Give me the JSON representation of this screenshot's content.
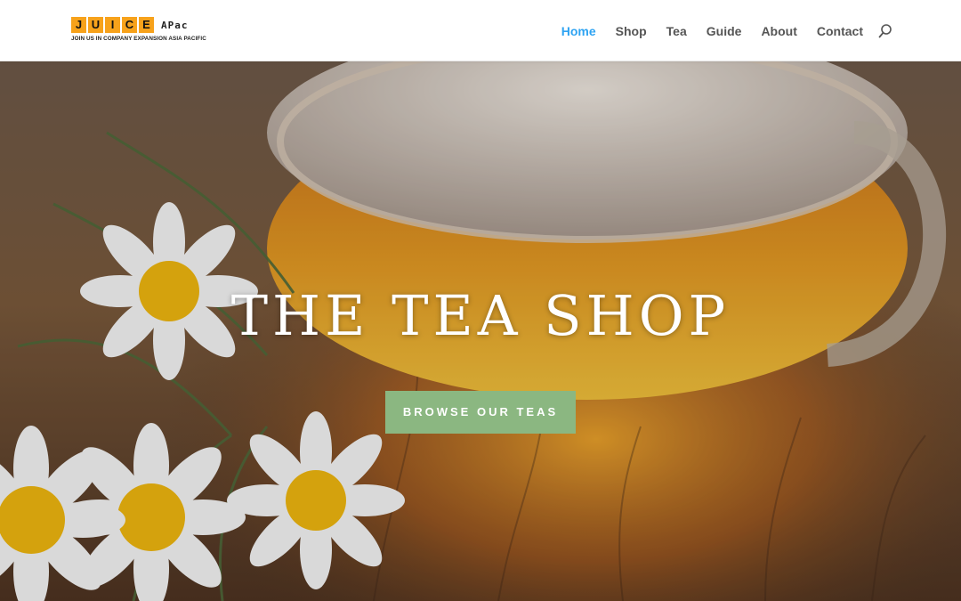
{
  "logo": {
    "letters": [
      "J",
      "U",
      "I",
      "C",
      "E"
    ],
    "suffix": "APac",
    "tagline": "JOIN US IN COMPANY EXPANSION ASIA PACIFIC"
  },
  "nav": {
    "items": [
      {
        "label": "Home",
        "active": true
      },
      {
        "label": "Shop",
        "active": false
      },
      {
        "label": "Tea",
        "active": false
      },
      {
        "label": "Guide",
        "active": false
      },
      {
        "label": "About",
        "active": false
      },
      {
        "label": "Contact",
        "active": false
      }
    ],
    "search_icon": "search-icon"
  },
  "hero": {
    "title": "THE TEA SHOP",
    "button_label": "BROWSE OUR TEAS"
  },
  "colors": {
    "accent": "#2ea3f2",
    "button": "#8bb781",
    "logo_orange": "#f7a21b",
    "nav_text": "#555555"
  }
}
